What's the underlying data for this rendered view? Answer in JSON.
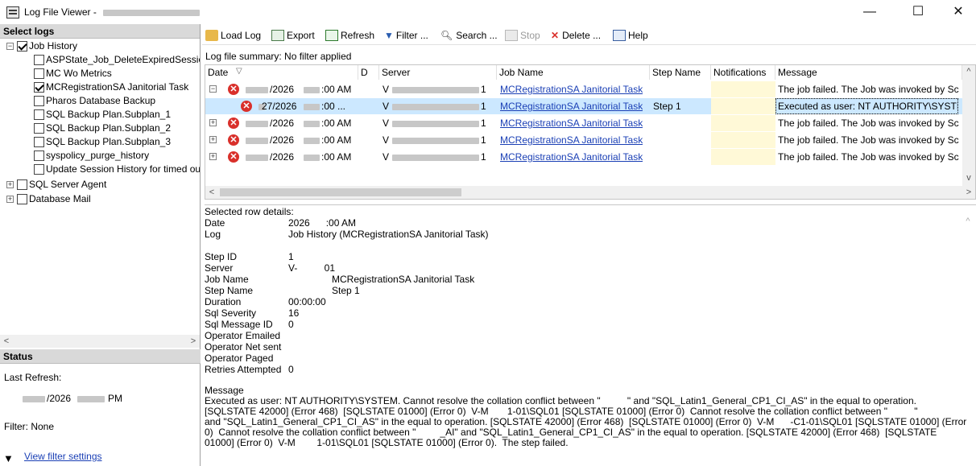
{
  "window": {
    "title": "Log File Viewer - ",
    "minimize": "—",
    "maximize": "☐",
    "close": "✕"
  },
  "left": {
    "select_logs_label": "Select logs",
    "tree": [
      {
        "label": "Job History",
        "checked": true,
        "expander": "−",
        "level": 0
      },
      {
        "label": "ASPState_Job_DeleteExpiredSessio",
        "checked": false,
        "level": 1
      },
      {
        "label": "MC Wo Metrics",
        "checked": false,
        "level": 1
      },
      {
        "label": "MCRegistrationSA Janitorial Task",
        "checked": true,
        "level": 1
      },
      {
        "label": "Pharos Database Backup",
        "checked": false,
        "level": 1
      },
      {
        "label": "SQL Backup Plan.Subplan_1",
        "checked": false,
        "level": 1
      },
      {
        "label": "SQL Backup Plan.Subplan_2",
        "checked": false,
        "level": 1
      },
      {
        "label": "SQL Backup Plan.Subplan_3",
        "checked": false,
        "level": 1
      },
      {
        "label": "syspolicy_purge_history",
        "checked": false,
        "level": 1
      },
      {
        "label": "Update Session History for timed out",
        "checked": false,
        "level": 1
      },
      {
        "label": "SQL Server Agent",
        "checked": false,
        "expander": "+",
        "level": 0
      },
      {
        "label": "Database Mail",
        "checked": false,
        "expander": "+",
        "level": 0
      }
    ],
    "status_label": "Status",
    "last_refresh_label": "Last Refresh:",
    "last_refresh_value": "/2026",
    "last_refresh_suffix": "PM",
    "filter_label": "Filter: None",
    "view_filter_link": "View filter settings"
  },
  "toolbar": {
    "load_log": "Load Log",
    "export": "Export",
    "refresh": "Refresh",
    "filter": "Filter ...",
    "search": "Search ...",
    "stop": "Stop",
    "delete": "Delete ...",
    "help": "Help"
  },
  "summary": "Log file summary: No filter applied",
  "grid": {
    "columns": [
      "Date",
      "D",
      "Server",
      "Job Name",
      "Step Name",
      "Notifications",
      "Message"
    ],
    "rows": [
      {
        "expander": "−",
        "date": "/2026",
        "time": ":00 AM",
        "server": "V",
        "server_end": "1",
        "job": "MCRegistrationSA Janitorial Task",
        "step": "",
        "message": "The job failed.  The Job was invoked by Sch",
        "child": false,
        "selected": false
      },
      {
        "expander": "",
        "date": "27/2026",
        "time": ":00 ...",
        "server": "V",
        "server_end": "1",
        "job": "MCRegistrationSA Janitorial Task",
        "step": "Step 1",
        "message": "Executed as user: NT AUTHORITY\\SYSTE",
        "child": true,
        "selected": true
      },
      {
        "expander": "+",
        "date": "/2026",
        "time": ":00 AM",
        "server": "V",
        "server_end": "1",
        "job": "MCRegistrationSA Janitorial Task",
        "step": "",
        "message": "The job failed.  The Job was invoked by Sch",
        "child": false,
        "selected": false
      },
      {
        "expander": "+",
        "date": "/2026",
        "time": ":00 AM",
        "server": "V",
        "server_end": "1",
        "job": "MCRegistrationSA Janitorial Task",
        "step": "",
        "message": "The job failed.  The Job was invoked by Sch",
        "child": false,
        "selected": false
      },
      {
        "expander": "+",
        "date": "/2026",
        "time": ":00 AM",
        "server": "V",
        "server_end": "1",
        "job": "MCRegistrationSA Janitorial Task",
        "step": "",
        "message": "The job failed.  The Job was invoked by Sch",
        "child": false,
        "selected": false
      }
    ]
  },
  "details": {
    "header": "Selected row details:",
    "fields": [
      {
        "label": "Date",
        "value": "2026      :00 AM"
      },
      {
        "label": "Log",
        "value": "Job History (MCRegistrationSA Janitorial Task)"
      },
      {
        "label": "",
        "value": ""
      },
      {
        "label": "Step ID",
        "value": "1"
      },
      {
        "label": "Server",
        "value": "V-          01"
      },
      {
        "label": "Job Name",
        "value": "MCRegistrationSA Janitorial Task"
      },
      {
        "label": "Step Name",
        "value": "Step 1"
      },
      {
        "label": "Duration",
        "value": "00:00:00"
      },
      {
        "label": "Sql Severity",
        "value": "16"
      },
      {
        "label": "Sql Message ID",
        "value": "0"
      },
      {
        "label": "Operator Emailed",
        "value": ""
      },
      {
        "label": "Operator Net sent",
        "value": ""
      },
      {
        "label": "Operator Paged",
        "value": ""
      },
      {
        "label": "Retries Attempted",
        "value": "0"
      }
    ],
    "message_label": "Message",
    "message_lines": [
      "Executed as user: NT AUTHORITY\\SYSTEM. Cannot resolve the collation conflict between \"          \" and \"SQL_Latin1_General_CP1_CI_AS\" in the equal to operation.",
      "[SQLSTATE 42000] (Error 468)  [SQLSTATE 01000] (Error 0)  V-M       1-01\\SQL01 [SQLSTATE 01000] (Error 0)  Cannot resolve the collation conflict between \"          \"",
      "and \"SQL_Latin1_General_CP1_CI_AS\" in the equal to operation. [SQLSTATE 42000] (Error 468)  [SQLSTATE 01000] (Error 0)  V-M      -C1-01\\SQL01 [SQLSTATE 01000] (Error",
      "0)  Cannot resolve the collation conflict between \"         _AI\" and \"SQL_Latin1_General_CP1_CI_AS\" in the equal to operation. [SQLSTATE 42000] (Error 468)  [SQLSTATE",
      "01000] (Error 0)  V-M        1-01\\SQL01 [SQLSTATE 01000] (Error 0).  The step failed."
    ]
  },
  "colors": {
    "link": "#1a3fb5",
    "selected_row": "#cce8ff",
    "error_icon": "#d9302b",
    "notification_bg": "#fff9d7"
  }
}
